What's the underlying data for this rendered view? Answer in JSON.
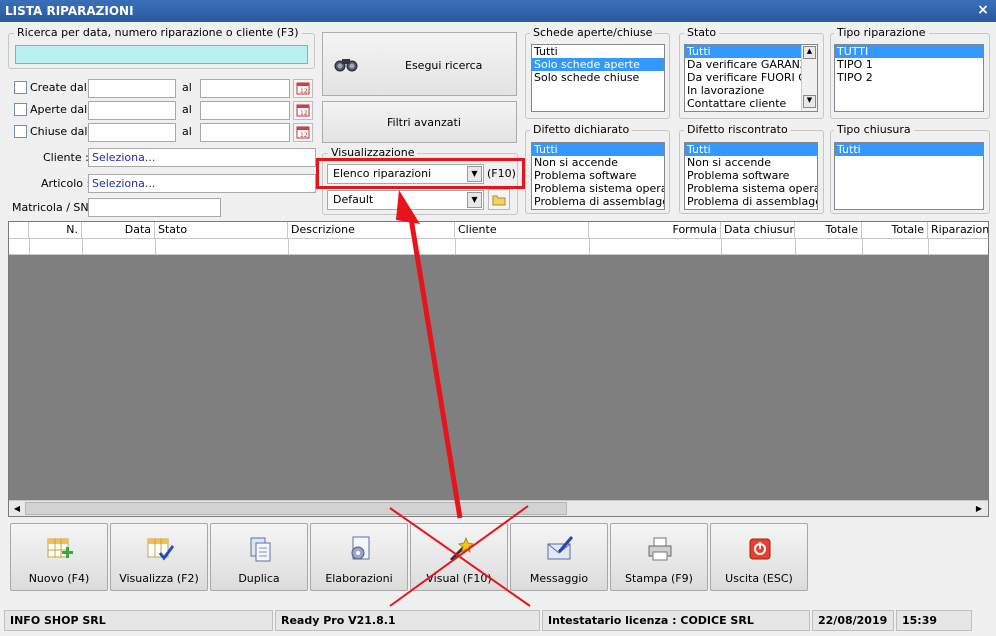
{
  "window": {
    "title": "LISTA RIPARAZIONI",
    "close_label": "×"
  },
  "search": {
    "label": "Ricerca per data, numero riparazione o cliente (F3)",
    "value": ""
  },
  "dates": {
    "rows": [
      {
        "label": "Create dal",
        "al": "al"
      },
      {
        "label": "Aperte dal",
        "al": "al"
      },
      {
        "label": "Chiuse dal",
        "al": "al"
      }
    ]
  },
  "filters": {
    "cliente_label": "Cliente :",
    "cliente_value": "Seleziona...",
    "articolo_label": "Articolo :",
    "articolo_value": "Seleziona...",
    "matricola_label": "Matricola / SN:"
  },
  "buttons": {
    "esegui": "Esegui ricerca",
    "filtri": "Filtri avanzati"
  },
  "visualizzazione": {
    "legend": "Visualizzazione",
    "selected": "Elenco riparazioni",
    "shortcut": "(F10)",
    "layout": "Default"
  },
  "lists": {
    "schede": {
      "title": "Schede aperte/chiuse",
      "items": [
        "Tutti",
        "Solo schede aperte",
        "Solo schede chiuse"
      ],
      "selected": 1
    },
    "stato": {
      "title": "Stato",
      "items": [
        "Tutti",
        "Da verificare GARANZIA",
        "Da verificare FUORI GA",
        "In lavorazione",
        "Contattare cliente"
      ],
      "selected": 0
    },
    "tipo_riparazione": {
      "title": "Tipo riparazione",
      "items": [
        "TUTTI",
        "TIPO 1",
        "TIPO 2"
      ],
      "selected": 0
    },
    "difetto_dichiarato": {
      "title": "Difetto dichiarato",
      "items": [
        "Tutti",
        "Non si accende",
        "Problema software",
        "Problema sistema operativo",
        "Problema di assemblaggio"
      ],
      "selected": 0
    },
    "difetto_riscontrato": {
      "title": "Difetto riscontrato",
      "items": [
        "Tutti",
        "Non si accende",
        "Problema software",
        "Problema sistema operativo",
        "Problema di assemblaggio"
      ],
      "selected": 0
    },
    "tipo_chiusura": {
      "title": "Tipo chiusura",
      "items": [
        "Tutti"
      ],
      "selected": 0
    }
  },
  "grid": {
    "columns": [
      "N.",
      "Data",
      "Stato",
      "Descrizione",
      "Cliente",
      "Formula",
      "Data chiusura",
      "Totale",
      "Totale",
      "Riparazione"
    ]
  },
  "toolbar": [
    {
      "label": "Nuovo (F4)",
      "icon": "grid-add-icon"
    },
    {
      "label": "Visualizza (F2)",
      "icon": "grid-check-icon"
    },
    {
      "label": "Duplica",
      "icon": "copy-documents-icon"
    },
    {
      "label": "Elaborazioni",
      "icon": "gear-document-icon"
    },
    {
      "label": "Visual (F10)",
      "icon": "magic-wand-icon"
    },
    {
      "label": "Messaggio",
      "icon": "envelope-pen-icon"
    },
    {
      "label": "Stampa (F9)",
      "icon": "printer-icon"
    },
    {
      "label": "Uscita (ESC)",
      "icon": "power-icon"
    }
  ],
  "statusbar": {
    "company": "INFO SHOP SRL",
    "version": "Ready Pro V21.8.1",
    "license": "Intestatario licenza : CODICE SRL",
    "date": "22/08/2019",
    "time": "15:39"
  },
  "colors": {
    "annotation": "#e8141b",
    "selection": "#3399ff",
    "search_field": "#b8f2f0"
  }
}
